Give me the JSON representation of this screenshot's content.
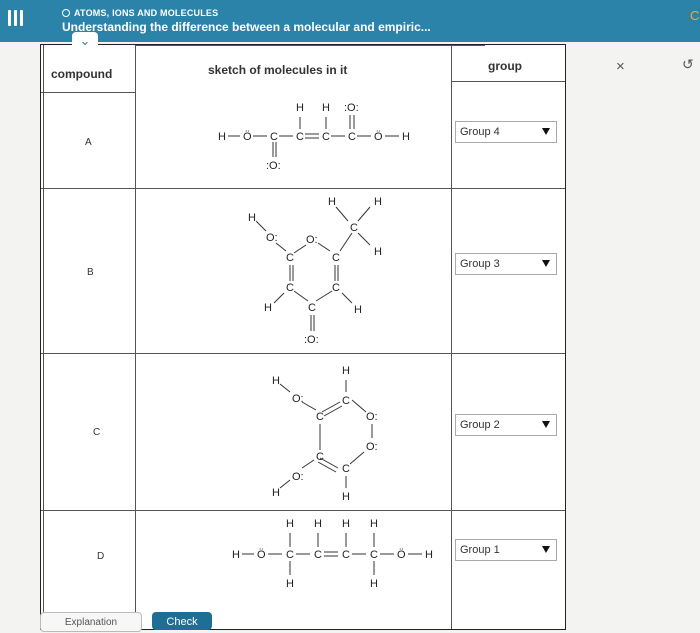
{
  "header": {
    "topic": "ATOMS, IONS AND MOLECULES",
    "title": "Understanding the difference between a molecular and empiric...",
    "accent_color": "#2c83aa"
  },
  "table": {
    "col_compound": "compound",
    "col_sketch": "sketch of molecules in it",
    "col_group": "group",
    "rows": [
      {
        "compound": "A",
        "group": "Group 4"
      },
      {
        "compound": "B",
        "group": "Group 3"
      },
      {
        "compound": "C",
        "group": "Group 2"
      },
      {
        "compound": "D",
        "group": "Group 1"
      }
    ]
  },
  "atoms": {
    "H": "H",
    "C": "C",
    "O_lone": "Ö",
    "O_top": ":O:",
    "O_dots": "O:"
  },
  "side": {
    "close": "×",
    "undo": "↺",
    "partial": "C"
  },
  "footer": {
    "explanation_label": "Explanation",
    "check_label": "Check"
  },
  "chevron": "⌄",
  "icons": [
    "menu-icon",
    "chevron-down-icon",
    "close-icon",
    "undo-icon",
    "dropdown-arrow-icon"
  ]
}
